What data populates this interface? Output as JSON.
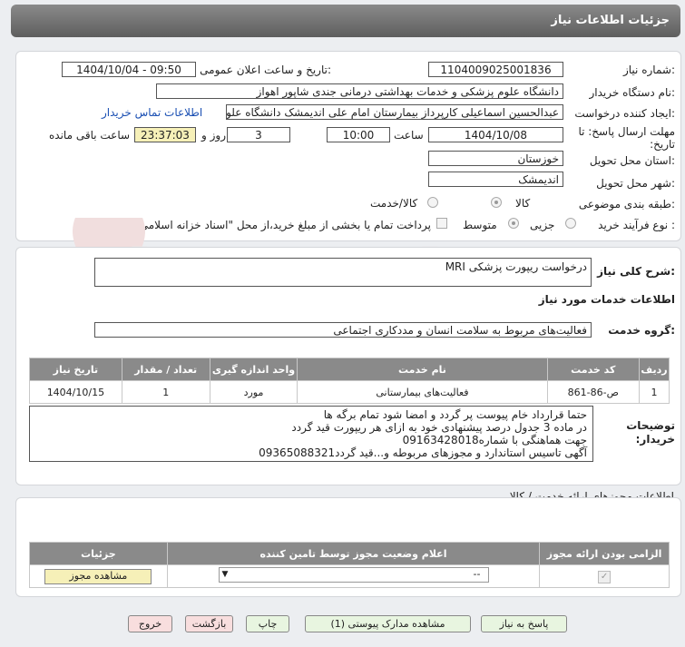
{
  "page_title": "جزئیات اطلاعات نیاز",
  "form": {
    "need_number_label": "شماره نیاز:",
    "need_number": "1104009025001836",
    "announce_label": "تاریخ و ساعت اعلان عمومی:",
    "announce_value": "1404/10/04 - 09:50",
    "buyer_org_label": "نام دستگاه خریدار:",
    "buyer_org": "دانشگاه علوم پزشکی و خدمات بهداشتی درمانی جندی شاپور اهواز",
    "creator_label": "ایجاد کننده درخواست:",
    "creator": "عبدالحسین اسماعیلی کارپرداز بیمارستان امام علی اندیمشک دانشگاه علوم پز",
    "contact_link": "اطلاعات تماس خریدار",
    "deadline_label": "مهلت ارسال پاسخ: تا تاریخ:",
    "deadline_date": "1404/10/08",
    "time_label": "ساعت",
    "deadline_time": "10:00",
    "days_value": "3",
    "days_label": "روز و",
    "remaining_time": "23:37:03",
    "remaining_label": "ساعت باقی مانده",
    "province_label": "استان محل تحویل:",
    "province": "خوزستان",
    "city_label": "شهر محل تحویل:",
    "city": "اندیمشک",
    "category_label": "طبقه بندی موضوعی:",
    "category_options": [
      "کالا",
      "کالا/خدمت"
    ],
    "purchase_type_label": "نوع فرآیند خرید :",
    "purchase_options": [
      "جزیی",
      "متوسط"
    ],
    "payment_note": "پرداخت تمام یا بخشی از مبلغ خرید،از محل \"اسناد خزانه اسلامی\" خواهد بود."
  },
  "summary": {
    "label": "شرح کلی نیاز:",
    "value": "درخواست ریپورت پزشکی MRI",
    "services_heading": "اطلاعات خدمات مورد نیاز",
    "group_label": "گروه خدمت:",
    "group_value": "فعالیت‌های مربوط به سلامت انسان و مددکاری اجتماعی"
  },
  "services_table": {
    "headers": [
      "ردیف",
      "کد خدمت",
      "نام خدمت",
      "واحد اندازه گیری",
      "تعداد / مقدار",
      "تاریخ نیاز"
    ],
    "rows": [
      [
        "1",
        "ص-86-861",
        "فعالیت‌های بیمارستانی",
        "مورد",
        "1",
        "1404/10/15"
      ]
    ]
  },
  "buyer_notes": {
    "label": "توضیحات خریدار:",
    "lines": [
      "حتما قرارداد خام پیوست پر گردد و امضا شود تمام برگه ها",
      "در ماده 3 جدول درصد پیشنهادی خود به ازای هر ریپورت قید گردد",
      "جهت هماهنگی با شماره09163428018",
      "آگهی تاسیس استاندارد و مجوزهای مربوطه و...قید گردد09365088321"
    ]
  },
  "permits": {
    "heading": "اطلاعات مجوزهای ارائه خدمت / کالا",
    "headers": [
      "الزامی بودن ارائه مجوز",
      "اعلام وضعیت مجوز توسط تامین کننده",
      "جزئیات"
    ],
    "select_value": "--",
    "view_button": "مشاهده مجوز"
  },
  "actions": {
    "reply": "پاسخ به نیاز",
    "attachments": "مشاهده مدارک پیوستی (1)",
    "print": "چاپ",
    "back": "بازگشت",
    "exit": "خروج"
  },
  "watermark": "AriaTender.neT",
  "colors": {
    "green_button": "#e8f5e0",
    "red_button": "#f8dede",
    "header": "#8a8a8a",
    "link": "#1a4fb3"
  }
}
